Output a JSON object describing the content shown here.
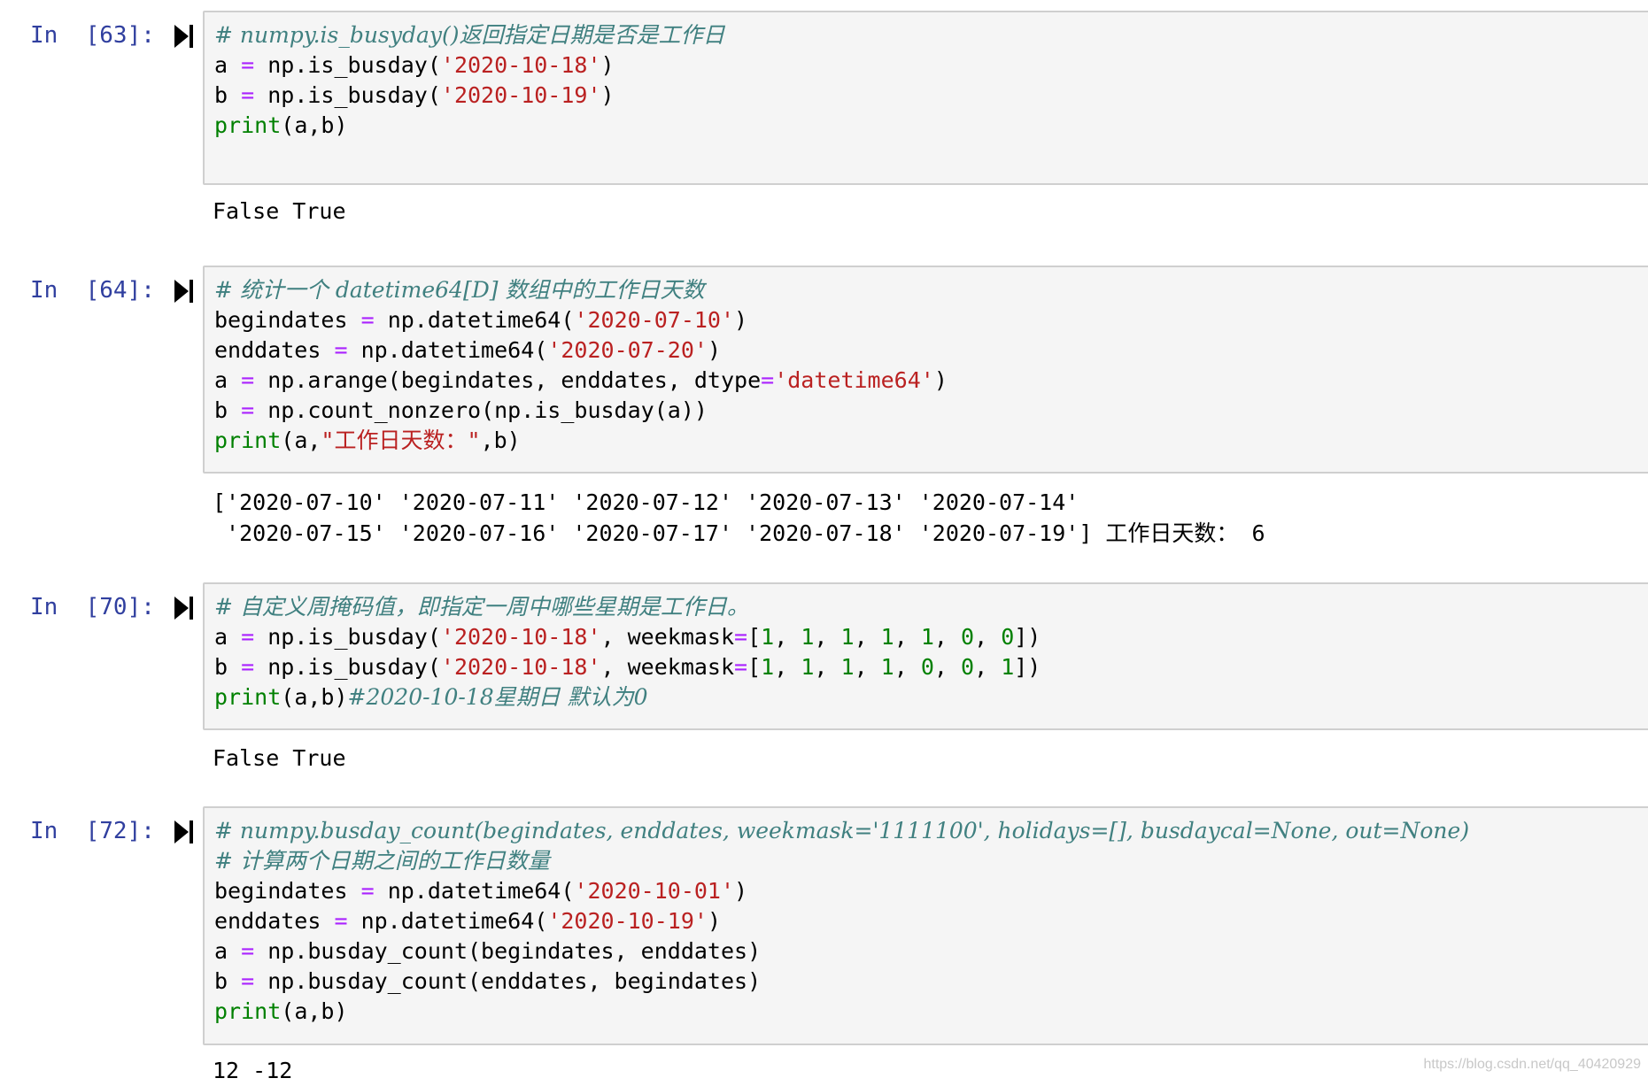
{
  "cells": [
    {
      "prompt": "In  [63]:",
      "code": [
        [
          [
            "cm",
            "# numpy.is_busyday()返回指定日期是否是工作日"
          ]
        ],
        [
          [
            "",
            "a "
          ],
          [
            "op",
            "="
          ],
          [
            "",
            " np.is_busday("
          ],
          [
            "st",
            "'2020-10-18'"
          ],
          [
            "",
            ")"
          ]
        ],
        [
          [
            "",
            "b "
          ],
          [
            "op",
            "="
          ],
          [
            "",
            " np.is_busday("
          ],
          [
            "st",
            "'2020-10-19'"
          ],
          [
            "",
            ")"
          ]
        ],
        [
          [
            "kw",
            "print"
          ],
          [
            "",
            "(a,b)"
          ]
        ],
        [
          [
            "",
            ""
          ]
        ]
      ],
      "output": [
        "False True"
      ]
    },
    {
      "prompt": "In  [64]:",
      "code": [
        [
          [
            "cm",
            "# 统计一个 datetime64[D] 数组中的工作日天数"
          ]
        ],
        [
          [
            "",
            "begindates "
          ],
          [
            "op",
            "="
          ],
          [
            "",
            " np.datetime64("
          ],
          [
            "st",
            "'2020-07-10'"
          ],
          [
            "",
            ")"
          ]
        ],
        [
          [
            "",
            "enddates "
          ],
          [
            "op",
            "="
          ],
          [
            "",
            " np.datetime64("
          ],
          [
            "st",
            "'2020-07-20'"
          ],
          [
            "",
            ")"
          ]
        ],
        [
          [
            "",
            "a "
          ],
          [
            "op",
            "="
          ],
          [
            "",
            " np.arange(begindates, enddates, dtype"
          ],
          [
            "op",
            "="
          ],
          [
            "st",
            "'datetime64'"
          ],
          [
            "",
            ")"
          ]
        ],
        [
          [
            "",
            "b "
          ],
          [
            "op",
            "="
          ],
          [
            "",
            " np.count_nonzero(np.is_busday(a))"
          ]
        ],
        [
          [
            "kw",
            "print"
          ],
          [
            "",
            "(a,"
          ],
          [
            "st",
            "\"工作日天数：\""
          ],
          [
            "",
            ",b)"
          ]
        ]
      ],
      "output": [
        "['2020-07-10' '2020-07-11' '2020-07-12' '2020-07-13' '2020-07-14'",
        " '2020-07-15' '2020-07-16' '2020-07-17' '2020-07-18' '2020-07-19'] 工作日天数： 6"
      ]
    },
    {
      "prompt": "In  [70]:",
      "code": [
        [
          [
            "cm",
            "# 自定义周掩码值，即指定一周中哪些星期是工作日。"
          ]
        ],
        [
          [
            "",
            "a "
          ],
          [
            "op",
            "="
          ],
          [
            "",
            " np.is_busday("
          ],
          [
            "st",
            "'2020-10-18'"
          ],
          [
            "",
            ", weekmask"
          ],
          [
            "op",
            "="
          ],
          [
            "",
            "["
          ],
          [
            "nu",
            "1"
          ],
          [
            "",
            ", "
          ],
          [
            "nu",
            "1"
          ],
          [
            "",
            ", "
          ],
          [
            "nu",
            "1"
          ],
          [
            "",
            ", "
          ],
          [
            "nu",
            "1"
          ],
          [
            "",
            ", "
          ],
          [
            "nu",
            "1"
          ],
          [
            "",
            ", "
          ],
          [
            "nu",
            "0"
          ],
          [
            "",
            ", "
          ],
          [
            "nu",
            "0"
          ],
          [
            "",
            "])"
          ]
        ],
        [
          [
            "",
            "b "
          ],
          [
            "op",
            "="
          ],
          [
            "",
            " np.is_busday("
          ],
          [
            "st",
            "'2020-10-18'"
          ],
          [
            "",
            ", weekmask"
          ],
          [
            "op",
            "="
          ],
          [
            "",
            "["
          ],
          [
            "nu",
            "1"
          ],
          [
            "",
            ", "
          ],
          [
            "nu",
            "1"
          ],
          [
            "",
            ", "
          ],
          [
            "nu",
            "1"
          ],
          [
            "",
            ", "
          ],
          [
            "nu",
            "1"
          ],
          [
            "",
            ", "
          ],
          [
            "nu",
            "0"
          ],
          [
            "",
            ", "
          ],
          [
            "nu",
            "0"
          ],
          [
            "",
            ", "
          ],
          [
            "nu",
            "1"
          ],
          [
            "",
            "])"
          ]
        ],
        [
          [
            "kw",
            "print"
          ],
          [
            "",
            "(a,b)"
          ],
          [
            "cm",
            "#2020-10-18星期日 默认为0"
          ]
        ]
      ],
      "output": [
        "False True"
      ]
    },
    {
      "prompt": "In  [72]:",
      "code": [
        [
          [
            "cm",
            "# numpy.busday_count(begindates, enddates, weekmask='1111100', holidays=[], busdaycal=None, out=None)"
          ]
        ],
        [
          [
            "cm",
            "# 计算两个日期之间的工作日数量"
          ]
        ],
        [
          [
            "",
            "begindates "
          ],
          [
            "op",
            "="
          ],
          [
            "",
            " np.datetime64("
          ],
          [
            "st",
            "'2020-10-01'"
          ],
          [
            "",
            ")"
          ]
        ],
        [
          [
            "",
            "enddates "
          ],
          [
            "op",
            "="
          ],
          [
            "",
            " np.datetime64("
          ],
          [
            "st",
            "'2020-10-19'"
          ],
          [
            "",
            ")"
          ]
        ],
        [
          [
            "",
            "a "
          ],
          [
            "op",
            "="
          ],
          [
            "",
            " np.busday_count(begindates, enddates)"
          ]
        ],
        [
          [
            "",
            "b "
          ],
          [
            "op",
            "="
          ],
          [
            "",
            " np.busday_count(enddates, begindates)"
          ]
        ],
        [
          [
            "kw",
            "print"
          ],
          [
            "",
            "(a,b)"
          ]
        ]
      ],
      "output": [
        "12 -12"
      ]
    }
  ],
  "watermark": "https://blog.csdn.net/qq_40420929",
  "colors": {
    "comment": "#408080",
    "string": "#ba2121",
    "keyword": "#008000",
    "operator": "#aa22ff",
    "prompt": "#303f9f",
    "cell_background": "#f5f5f5",
    "cell_border": "#cfcfcf"
  },
  "icons": {
    "run": "run-cell-icon"
  }
}
